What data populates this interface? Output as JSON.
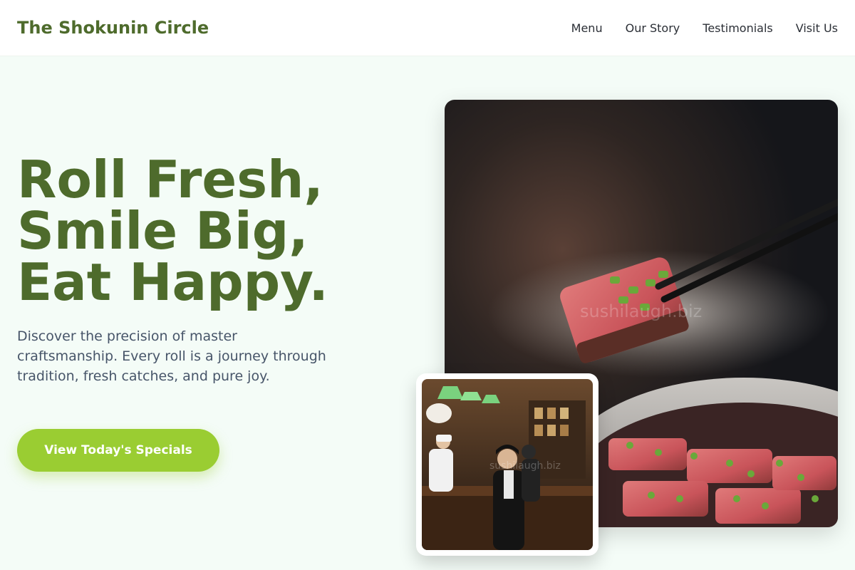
{
  "header": {
    "brand": "The Shokunin Circle",
    "nav": [
      "Menu",
      "Our Story",
      "Testimonials",
      "Visit Us"
    ]
  },
  "hero": {
    "title_lines": [
      "Roll Fresh,",
      "Smile Big,",
      "Eat Happy."
    ],
    "subtitle": "Discover the precision of master craftsmanship. Every roll is a journey through tradition, fresh catches, and pure joy.",
    "cta_label": "View Today's Specials"
  },
  "images": {
    "main_watermark": "sushilaugh.biz",
    "inset_watermark": "sushilaugh.biz"
  },
  "colors": {
    "brand": "#4e6b2c",
    "accent": "#9acd32",
    "background": "#f4fcf7"
  }
}
